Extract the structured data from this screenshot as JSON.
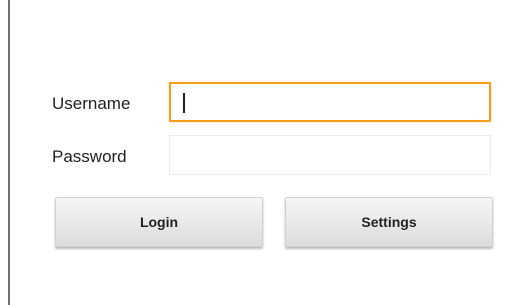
{
  "form": {
    "username_label": "Username",
    "username_value": "",
    "password_label": "Password",
    "password_value": ""
  },
  "buttons": {
    "login_label": "Login",
    "settings_label": "Settings"
  },
  "colors": {
    "focus_border": "#f59e1b",
    "button_face": "#e8e8e8",
    "divider": "#6f6f6f"
  }
}
